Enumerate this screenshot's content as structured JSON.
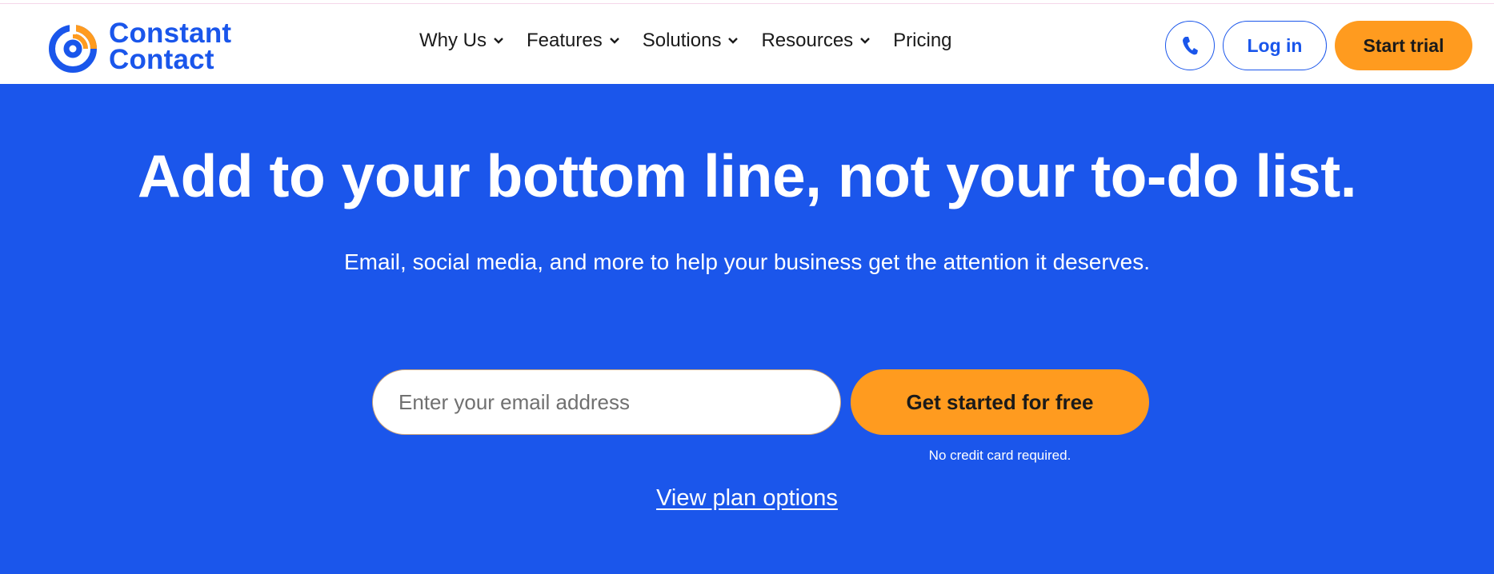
{
  "brand": {
    "name_line1": "Constant",
    "name_line2": "Contact",
    "primary_color": "#1a56eb",
    "accent_color": "#ff9b1f"
  },
  "nav": {
    "items": [
      {
        "label": "Why Us",
        "has_dropdown": true
      },
      {
        "label": "Features",
        "has_dropdown": true
      },
      {
        "label": "Solutions",
        "has_dropdown": true
      },
      {
        "label": "Resources",
        "has_dropdown": true
      },
      {
        "label": "Pricing",
        "has_dropdown": false
      }
    ]
  },
  "header_actions": {
    "phone_icon": "phone-icon",
    "login_label": "Log in",
    "trial_label": "Start trial"
  },
  "hero": {
    "headline": "Add to your bottom line, not your to-do list.",
    "subhead": "Email, social media, and more to help your business get the attention it deserves.",
    "email_placeholder": "Enter your email address",
    "email_value": "",
    "cta_label": "Get started for free",
    "note": "No credit card required.",
    "plan_link": "View plan options",
    "background_color": "#1b56eb"
  }
}
